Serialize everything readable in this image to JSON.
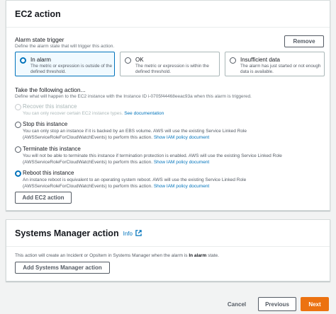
{
  "ec2": {
    "title": "EC2 action",
    "remove_label": "Remove",
    "trigger": {
      "label": "Alarm state trigger",
      "description": "Define the alarm state that will trigger this action.",
      "tiles": [
        {
          "label": "In alarm",
          "description": "The metric or expression is outside of the defined threshold.",
          "selected": true
        },
        {
          "label": "OK",
          "description": "The metric or expression is within the defined threshold.",
          "selected": false
        },
        {
          "label": "Insufficient data",
          "description": "The alarm has just started or not enough data is available.",
          "selected": false
        }
      ]
    },
    "action": {
      "label": "Take the following action...",
      "description": "Define what will happen to the EC2 instance with the Instance ID i-0705f44468eeac93a when this alarm is triggered.",
      "options": [
        {
          "label": "Recover this instance",
          "description": "You can only recover certain EC2 instance types.",
          "link": "See documentation",
          "disabled": true,
          "checked": false
        },
        {
          "label": "Stop this instance",
          "description": "You can only stop an instance if it is backed by an EBS volume. AWS will use the existing Service Linked Role (AWSServiceRoleForCloudWatchEvents) to perform this action.",
          "link": "Show IAM policy document",
          "disabled": false,
          "checked": false
        },
        {
          "label": "Terminate this instance",
          "description": "You will not be able to terminate this instance if termination protection is enabled. AWS will use the existing Service Linked Role (AWSServiceRoleForCloudWatchEvents) to perform this action.",
          "link": "Show IAM policy document",
          "disabled": false,
          "checked": false
        },
        {
          "label": "Reboot this instance",
          "description": "An instance reboot is equivalent to an operating system reboot. AWS will use the existing Service Linked Role (AWSServiceRoleForCloudWatchEvents) to perform this action.",
          "link": "Show IAM policy document",
          "disabled": false,
          "checked": true
        }
      ]
    },
    "add_label": "Add EC2 action"
  },
  "ssm": {
    "title": "Systems Manager action",
    "info_label": "Info",
    "description_prefix": "This action will create an Incident or OpsItem in Systems Manager when the alarm is",
    "description_state": "In alarm",
    "description_suffix": "state.",
    "add_label": "Add Systems Manager action"
  },
  "footer": {
    "cancel_label": "Cancel",
    "previous_label": "Previous",
    "next_label": "Next"
  },
  "colors": {
    "accent": "#0073bb",
    "primary_button": "#ec7211",
    "page_bg": "#f2f3f3"
  }
}
